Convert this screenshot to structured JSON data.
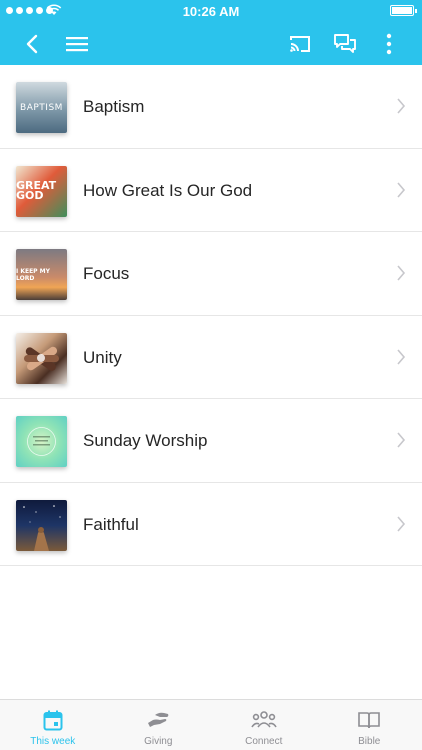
{
  "status_bar": {
    "time": "10:26 AM"
  },
  "nav": {
    "back_icon": "chevron-left-icon",
    "menu_icon": "hamburger-menu-icon",
    "cast_icon": "cast-icon",
    "chat_icon": "chat-bubbles-icon",
    "more_icon": "more-vertical-icon"
  },
  "list": {
    "items": [
      {
        "title": "Baptism",
        "thumb_text": "BAPTISM"
      },
      {
        "title": "How Great Is Our God",
        "thumb_text": "GREAT GOD"
      },
      {
        "title": "Focus",
        "thumb_text": "I KEEP MY LORD"
      },
      {
        "title": "Unity"
      },
      {
        "title": "Sunday Worship"
      },
      {
        "title": "Faithful"
      }
    ]
  },
  "tabs": [
    {
      "label": "This week",
      "icon": "calendar-icon",
      "active": true
    },
    {
      "label": "Giving",
      "icon": "giving-hand-icon",
      "active": false
    },
    {
      "label": "Connect",
      "icon": "people-group-icon",
      "active": false
    },
    {
      "label": "Bible",
      "icon": "open-book-icon",
      "active": false
    }
  ],
  "colors": {
    "accent": "#2bc3ec",
    "text": "#262626",
    "tab_inactive": "#8e8e93",
    "divider": "#e6e6e6"
  }
}
